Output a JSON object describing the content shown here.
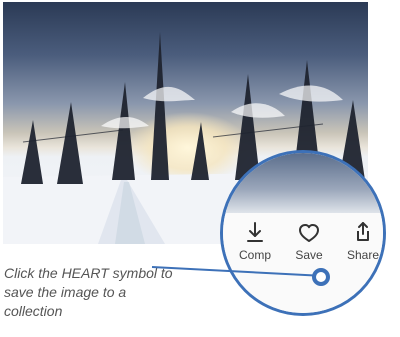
{
  "image": {
    "subject": "snowy-forest-sunset",
    "colors": {
      "accent": "#3d71b8"
    }
  },
  "actions": [
    {
      "label": "Comp",
      "icon": "download-icon"
    },
    {
      "label": "Save",
      "icon": "heart-icon"
    },
    {
      "label": "Share",
      "icon": "share-icon"
    }
  ],
  "callout": {
    "text": "Click the HEART symbol to save the image to a collection"
  }
}
